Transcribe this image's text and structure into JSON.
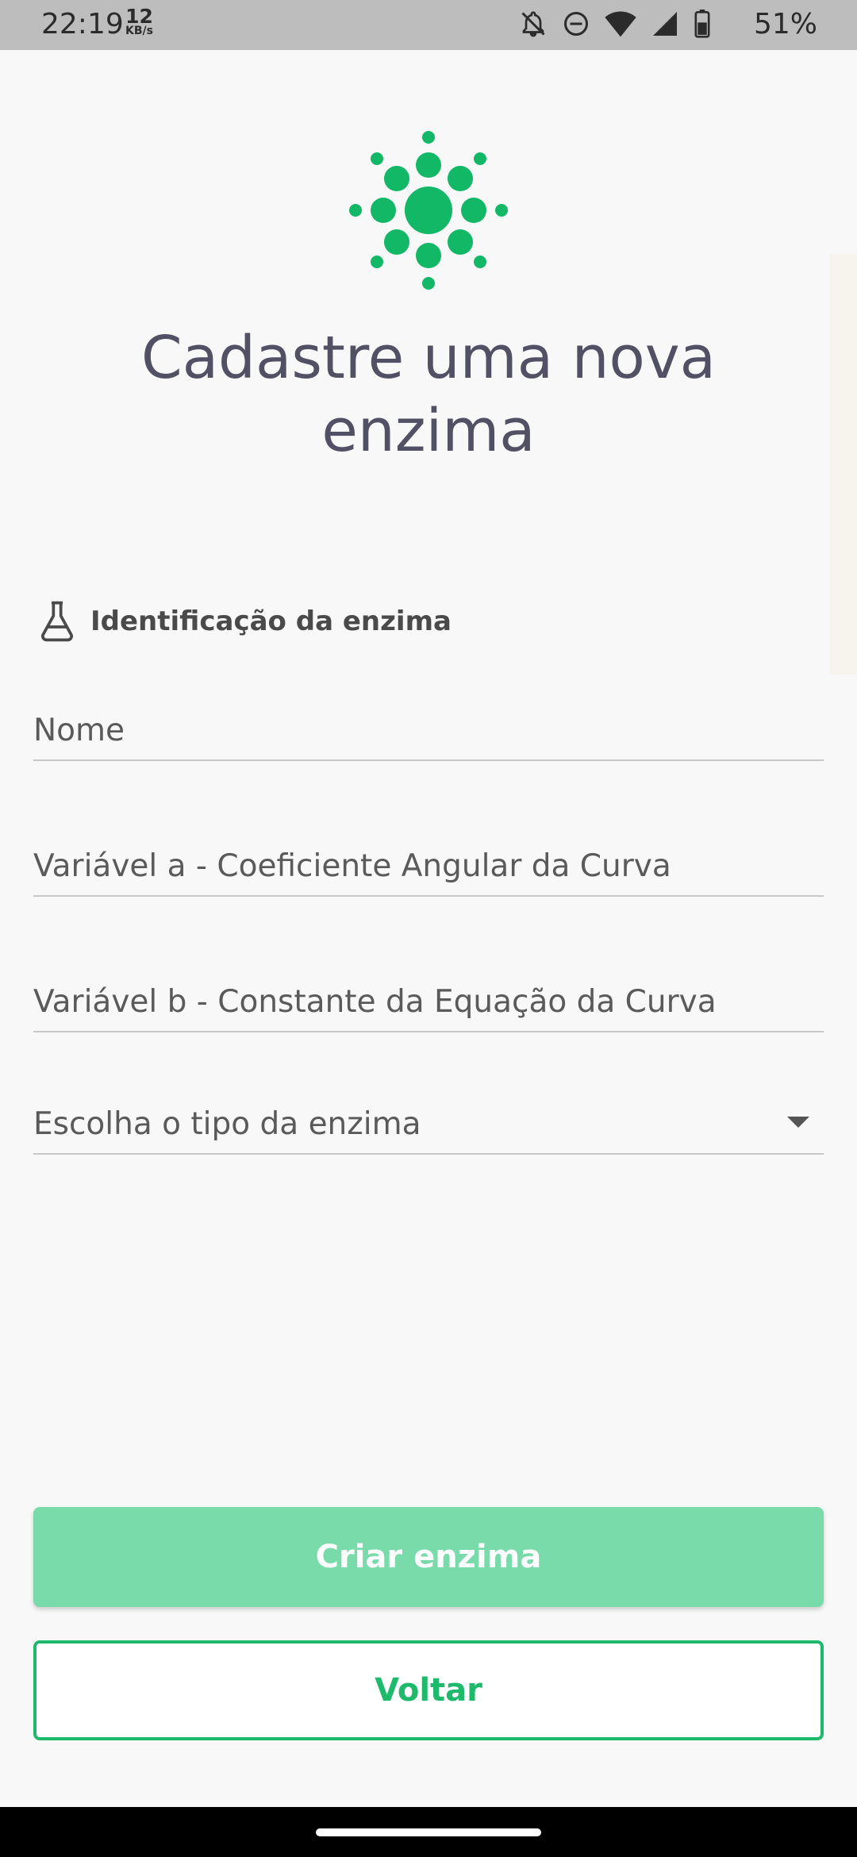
{
  "status_bar": {
    "time": "22:19",
    "net_speed_value": "12",
    "net_speed_unit": "KB/s",
    "battery": "51%",
    "icons": [
      "notifications-off-icon",
      "do-not-disturb-icon",
      "wifi-icon",
      "signal-icon",
      "battery-icon"
    ]
  },
  "logo": {
    "icon": "enzyme-dots-logo",
    "color": "#12b866"
  },
  "page": {
    "title": "Cadastre uma nova enzima"
  },
  "section": {
    "icon": "flask-icon",
    "label": "Identificação da enzima"
  },
  "form": {
    "name_placeholder": "Nome",
    "var_a_placeholder": "Variável a - Coeficiente Angular da Curva",
    "var_b_placeholder": "Variável b - Constante da Equação da Curva",
    "type_select_placeholder": "Escolha o tipo da enzima"
  },
  "buttons": {
    "create_label": "Criar enzima",
    "back_label": "Voltar"
  },
  "colors": {
    "accent": "#1dba6c",
    "primary_disabled": "#79dba9",
    "title": "#515064"
  }
}
